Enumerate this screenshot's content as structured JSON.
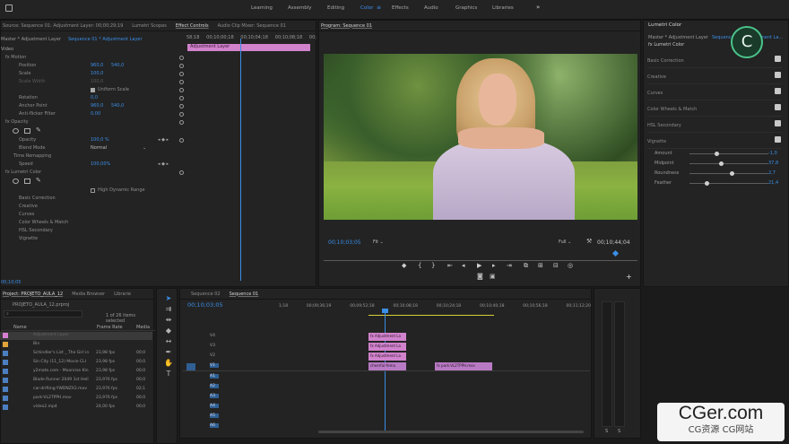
{
  "workspaces": [
    "Learning",
    "Assembly",
    "Editing",
    "Color",
    "Effects",
    "Audio",
    "Graphics",
    "Libraries"
  ],
  "active_workspace": "Color",
  "more_glyph": "»",
  "top_tabs": {
    "source": "Source: Sequence 01: Adjustment Layer: 00;00;29;19",
    "scopes": "Lumetri Scopes",
    "effect_controls": "Effect Controls",
    "audio_mixer": "Audio Clip Mixer: Sequence 01"
  },
  "effect_controls": {
    "master_label": "Master * Adjustment Layer",
    "seq_label": "Sequence 01 * Adjustment Layer",
    "ruler": [
      "58;18",
      "00;10;00;18",
      "00;10;04;18",
      "00;10;08;18",
      "00;"
    ],
    "clip_label": "Adjustment Layer",
    "video_label": "Video",
    "timecode": "00;10;05",
    "rows": [
      {
        "name": "fx  Motion"
      },
      {
        "name": "Position",
        "v1": "960,0",
        "v2": "540,0"
      },
      {
        "name": "Scale",
        "v1": "100,0"
      },
      {
        "name": "Scale Width",
        "v1": "100,0"
      },
      {
        "name": "Uniform Scale"
      },
      {
        "name": "Rotation",
        "v1": "0,0"
      },
      {
        "name": "Anchor Point",
        "v1": "960,0",
        "v2": "540,0"
      },
      {
        "name": "Anti-flicker Filter",
        "v1": "0,00"
      },
      {
        "name": "fx  Opacity"
      },
      {
        "name": "Opacity",
        "v1": "100,0 %"
      },
      {
        "name": "Blend Mode",
        "v1": "Normal"
      },
      {
        "name": "Time Remapping"
      },
      {
        "name": "Speed",
        "v1": "100,00%"
      },
      {
        "name": "fx  Lumetri Color"
      },
      {
        "name": "High Dynamic Range"
      },
      {
        "name": "Basic Correction"
      },
      {
        "name": "Creative"
      },
      {
        "name": "Curves"
      },
      {
        "name": "Color Wheels & Match"
      },
      {
        "name": "HSL Secondary"
      },
      {
        "name": "Vignette"
      }
    ]
  },
  "program": {
    "title": "Program: Sequence 01",
    "timecode": "00;10;03;05",
    "fit": "Fit",
    "quality": "Full",
    "duration": "00;10;44;04"
  },
  "lumetri": {
    "title": "Lumetri Color",
    "master": "Master * Adjustment Layer",
    "seq": "Sequence 01 * Adjustment La...",
    "preset": "Lumetri Color",
    "sections": [
      "Basic Correction",
      "Creative",
      "Curves",
      "Color Wheels & Match",
      "HSL Secondary",
      "Vignette"
    ],
    "vignette": [
      {
        "name": "Amount",
        "value": "-1,0",
        "pos": 0.32
      },
      {
        "name": "Midpoint",
        "value": "37,8",
        "pos": 0.38
      },
      {
        "name": "Roundness",
        "value": "2,7",
        "pos": 0.52
      },
      {
        "name": "Feather",
        "value": "21,4",
        "pos": 0.2
      }
    ]
  },
  "project": {
    "tabs": [
      "Project: PROJETO_AULA_12",
      "Media Browser",
      "Librarie"
    ],
    "file": "PROJETO_AULA_12.prproj",
    "count": "1 of 26 items selected",
    "columns": [
      "Name",
      "Frame Rate",
      "Media"
    ],
    "items": [
      {
        "name": "Adjustment Layer",
        "rate": "",
        "media": "",
        "color": "#d67fd0"
      },
      {
        "name": "Bin",
        "rate": "",
        "media": "",
        "color": "#e0a43a"
      },
      {
        "name": "Schindler's List _ The Girl in",
        "rate": "23,98 fps",
        "media": "00;0",
        "color": "#4c7fc2"
      },
      {
        "name": "Sin City (11_12) Movie CLI",
        "rate": "23,98 fps",
        "media": "00;0",
        "color": "#4c7fc2"
      },
      {
        "name": "y2mate.com - Moonrise Kin",
        "rate": "23,98 fps",
        "media": "00;0",
        "color": "#4c7fc2"
      },
      {
        "name": "Blade Runner 2049 1st Hell",
        "rate": "23,976 fps",
        "media": "00;0",
        "color": "#4c7fc2"
      },
      {
        "name": "car-drifting-YWDNZX2.mov",
        "rate": "23,976 fps",
        "media": "02;1",
        "color": "#4c7fc2"
      },
      {
        "name": "park-VL2TPPH.mov",
        "rate": "23,976 fps",
        "media": "00;0",
        "color": "#4c7fc2"
      },
      {
        "name": "video2.mp4",
        "rate": "24,00 fps",
        "media": "00;0",
        "color": "#4c7fc2"
      }
    ]
  },
  "timeline": {
    "tabs": [
      "Sequence 02",
      "Sequence 01"
    ],
    "timecode": "00;10;03;05",
    "ruler": [
      "1;18",
      "00;09;36;19",
      "00;09;52;18",
      "00;10;08;18",
      "00;10;24;18",
      "00;10;40;18",
      "00;10;56;18",
      "00;11;12;20"
    ],
    "tracks": [
      "V4",
      "V3",
      "V2",
      "V1",
      "A1",
      "A2",
      "A3",
      "A4",
      "A5",
      "A6"
    ],
    "clips": [
      {
        "label": "fx  Adjustment La",
        "track": "V4"
      },
      {
        "label": "fx  Adjustment La",
        "track": "V3"
      },
      {
        "label": "fx  Adjustment La",
        "track": "V2"
      },
      {
        "label": "cheerful-fema",
        "track": "V1"
      },
      {
        "label": "fx  park-VL2TPPH.mov",
        "track": "V1b"
      }
    ]
  },
  "meter": {
    "labels": [
      "S",
      "S"
    ]
  },
  "watermark": {
    "brand": "CGer.com",
    "sub": "CG资源 CG网站"
  }
}
